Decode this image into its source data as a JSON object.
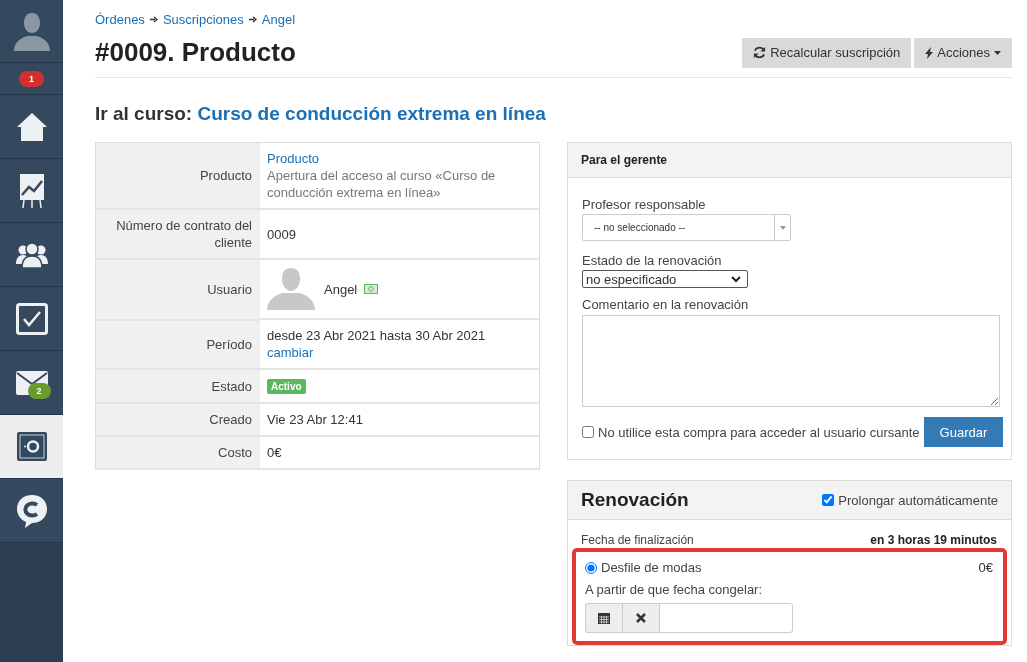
{
  "sidebar": {
    "avatar_badge": "1",
    "items": [
      {
        "kind": "home",
        "selected": false
      },
      {
        "kind": "chart",
        "selected": false
      },
      {
        "kind": "people",
        "selected": false
      },
      {
        "kind": "check",
        "selected": false
      },
      {
        "kind": "mail",
        "selected": false,
        "badge": "2"
      },
      {
        "kind": "safe",
        "selected": true
      },
      {
        "kind": "chat",
        "selected": false
      }
    ]
  },
  "breadcrumb": [
    "Órdenes",
    "Suscripciones",
    "Angel"
  ],
  "title": "#0009. Producto",
  "buttons": [
    {
      "kind": "refresh",
      "label": "Recalcular suscripción"
    },
    {
      "kind": "actions",
      "label": "Acciones"
    }
  ],
  "course": {
    "label": "Ir al curso:",
    "link": "Curso de conducción extrema en línea"
  },
  "details": [
    {
      "kind": "product",
      "label": "Producto",
      "link": "Producto",
      "value": "Apertura del acceso al curso «Curso de conducción extrema en línea»"
    },
    {
      "kind": "text",
      "label": "Número de contrato del cliente",
      "value": "0009"
    },
    {
      "kind": "user",
      "label": "Usuario",
      "value": "Angel"
    },
    {
      "kind": "period",
      "label": "Período",
      "value": "desde 23 Abr 2021 hasta 30 Abr 2021",
      "link": "cambiar"
    },
    {
      "kind": "status",
      "label": "Estado",
      "value": "Activo"
    },
    {
      "kind": "text",
      "label": "Creado",
      "value": "Vie 23 Abr 12:41"
    },
    {
      "kind": "text",
      "label": "Costo",
      "value": "0€"
    }
  ],
  "manager": {
    "title": "Para el gerente",
    "teacher": {
      "label": "Profesor responsable",
      "value": "-- no seleccionado --"
    },
    "renewal_state": {
      "label": "Estado de la renovación",
      "value": "no especificado"
    },
    "comment": {
      "label": "Comentario en la renovación"
    },
    "no_access": {
      "label": "No utilice esta compra para acceder al usuario cursante",
      "checked": false
    },
    "save": "Guardar"
  },
  "renewal": {
    "title": "Renovación",
    "auto": {
      "label": "Prolongar automáticamente",
      "checked": true
    },
    "end_label": "Fecha de finalización",
    "end_value": "en 3 horas 19 minutos",
    "option": {
      "label": "Desfile de modas",
      "selected": true,
      "price": "0€",
      "highlighted": true,
      "freeze_label": "A partir de que fecha congelar:"
    }
  }
}
